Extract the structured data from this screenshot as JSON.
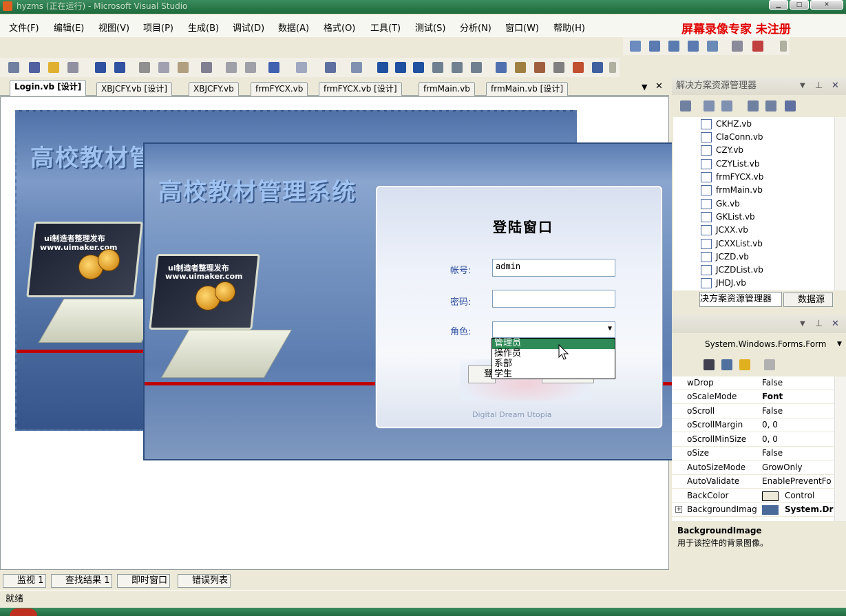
{
  "window": {
    "title": "hyzms (正在运行) - Microsoft Visual Studio"
  },
  "menu": [
    "文件(F)",
    "编辑(E)",
    "视图(V)",
    "项目(P)",
    "生成(B)",
    "调试(D)",
    "数据(A)",
    "格式(O)",
    "工具(T)",
    "测试(S)",
    "分析(N)",
    "窗口(W)",
    "帮助(H)"
  ],
  "watermark": "屏幕录像专家  未注册",
  "tabs": [
    "Login.vb [设计]",
    "XBJCFY.vb [设计]",
    "XBJCFY.vb",
    "frmFYCX.vb",
    "frmFYCX.vb [设计]",
    "frmMain.vb",
    "frmMain.vb [设计]"
  ],
  "form": {
    "title_back": "高校教材管",
    "title_front": "高校教材管理系统",
    "laptop_text1": "ui制造者整理发布",
    "laptop_text2": "www.uimaker.com"
  },
  "login": {
    "heading": "登陆窗口",
    "account_label": "帐号:",
    "account_value": "admin",
    "password_label": "密码:",
    "role_label": "角色:",
    "button_partial": "登",
    "footer": "Digital Dream Utopia",
    "role_options": [
      "管理员",
      "操作员",
      "系部",
      "学生"
    ]
  },
  "solution": {
    "header": "解决方案资源管理器",
    "files": [
      "CKHZ.vb",
      "ClaConn.vb",
      "CZY.vb",
      "CZYList.vb",
      "frmFYCX.vb",
      "frmMain.vb",
      "Gk.vb",
      "GKList.vb",
      "JCXX.vb",
      "JCXXList.vb",
      "JCZD.vb",
      "JCZDList.vb",
      "JHDJ.vb"
    ],
    "tab1": "决方案资源管理器",
    "tab2": "数据源"
  },
  "properties": {
    "object": "System.Windows.Forms.Form",
    "rows": [
      {
        "name": "wDrop",
        "value": "False"
      },
      {
        "name": "oScaleMode",
        "value": "Font"
      },
      {
        "name": "oScroll",
        "value": "False"
      },
      {
        "name": "oScrollMargin",
        "value": "0, 0"
      },
      {
        "name": "oScrollMinSize",
        "value": "0, 0"
      },
      {
        "name": "oSize",
        "value": "False"
      },
      {
        "name": "AutoSizeMode",
        "value": "GrowOnly"
      },
      {
        "name": "AutoValidate",
        "value": "EnablePreventFo"
      },
      {
        "name": "BackColor",
        "value": "Control"
      },
      {
        "name": "BackgroundImage",
        "value": "System.Dr"
      }
    ],
    "desc_title": "BackgroundImage",
    "desc_text": "用于该控件的背景图像。"
  },
  "bottom_tabs": [
    "监视 1",
    "查找结果 1",
    "即时窗口",
    "错误列表"
  ],
  "status": "就绪"
}
